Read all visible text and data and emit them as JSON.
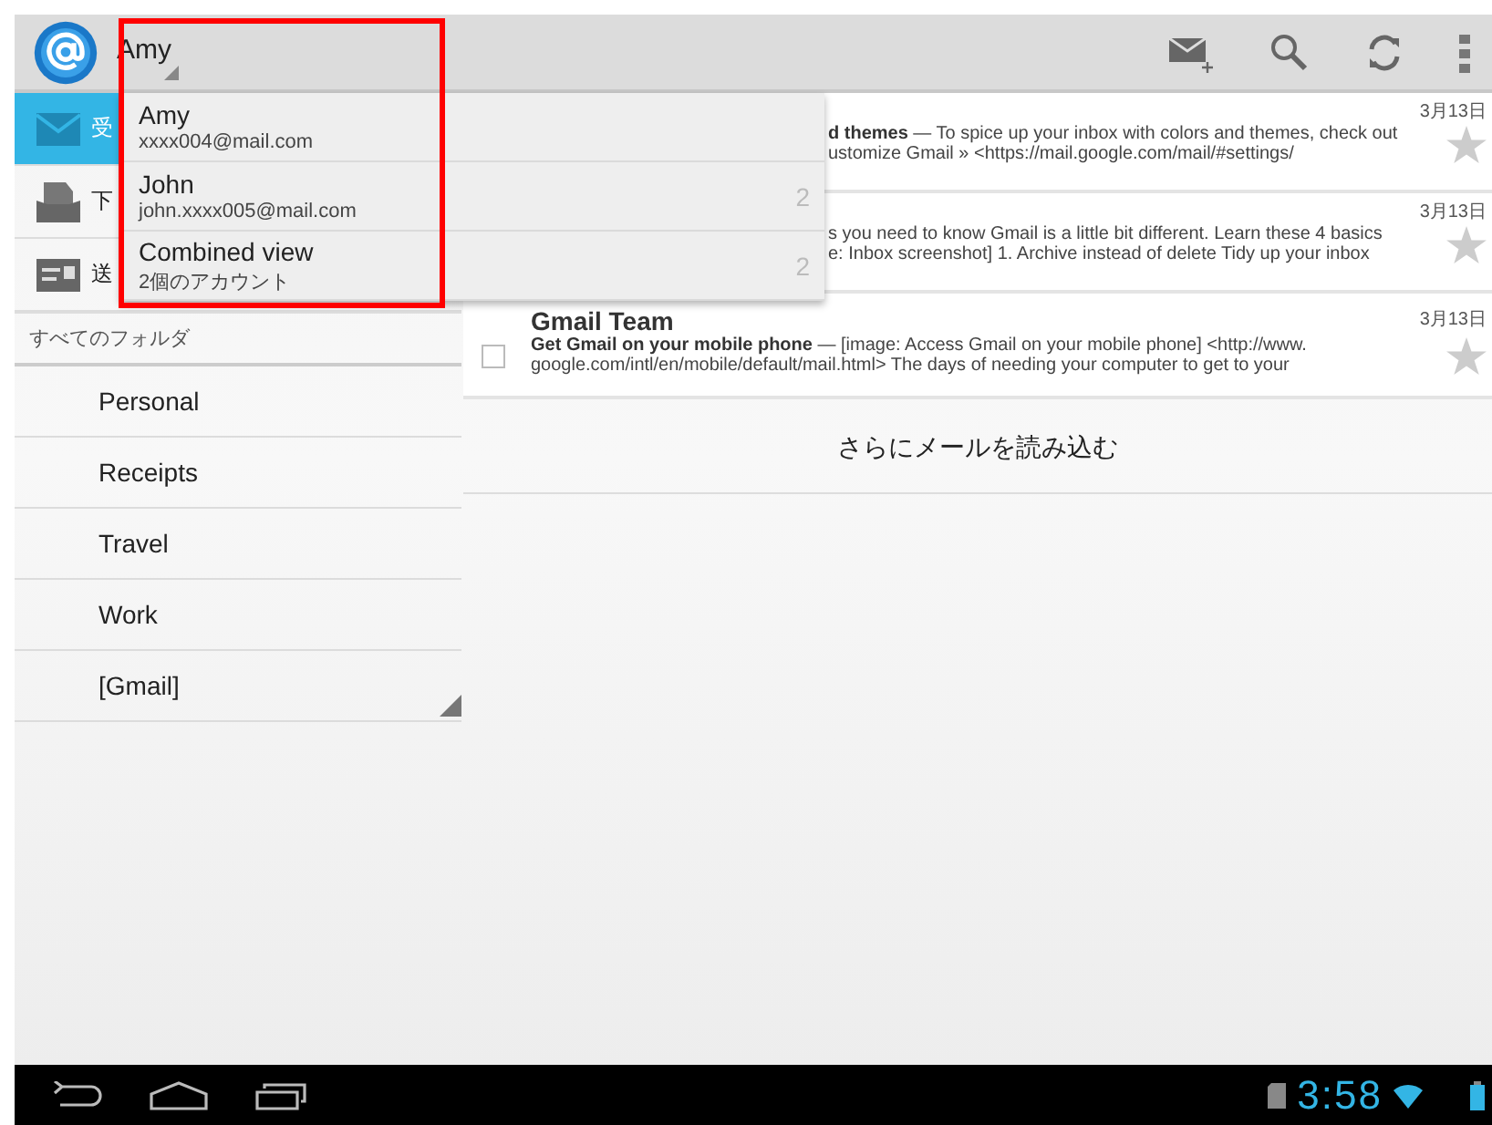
{
  "action_bar": {
    "account": "Amy"
  },
  "sidebar": {
    "items": [
      {
        "label": "受",
        "selected": true,
        "kind": "inbox"
      },
      {
        "label": "下",
        "selected": false,
        "kind": "drafts"
      },
      {
        "label": "送",
        "selected": false,
        "kind": "sent"
      }
    ],
    "header": "すべてのフォルダ",
    "folders": [
      {
        "label": "Personal",
        "has_corner": false
      },
      {
        "label": "Receipts",
        "has_corner": false
      },
      {
        "label": "Travel",
        "has_corner": false
      },
      {
        "label": "Work",
        "has_corner": false
      },
      {
        "label": "[Gmail]",
        "has_corner": true
      }
    ]
  },
  "emails": [
    {
      "kind": "covered",
      "date": "3月13日",
      "subject": "d themes",
      "snippet_1": " — To spice up your inbox with colors and themes, check out",
      "snippet_2": "ustomize Gmail » <https://mail.google.com/mail/#settings/"
    },
    {
      "kind": "covered",
      "date": "3月13日",
      "snippet_1": "s you need to know Gmail is a little bit different. Learn these 4 basics",
      "snippet_2": "e: Inbox screenshot] 1. Archive instead of delete Tidy up your inbox"
    },
    {
      "kind": "full",
      "date": "3月13日",
      "sender": "Gmail Team",
      "checked": false,
      "subject": "Get Gmail on your mobile phone",
      "snippet_1": " — [image: Access Gmail on your mobile phone] <http://www.",
      "snippet_2": "google.com/intl/en/mobile/default/mail.html> The days of needing your computer to get to your"
    }
  ],
  "load_more": "さらにメールを読み込む",
  "account_dropdown": [
    {
      "name": "Amy",
      "detail": "xxxx004@mail.com"
    },
    {
      "name": "John",
      "detail": "john.xxxx005@mail.com",
      "count": "2"
    },
    {
      "name": "Combined view",
      "detail": "2個のアカウント",
      "count": "2"
    }
  ],
  "status_bar": {
    "time": "3:58"
  }
}
